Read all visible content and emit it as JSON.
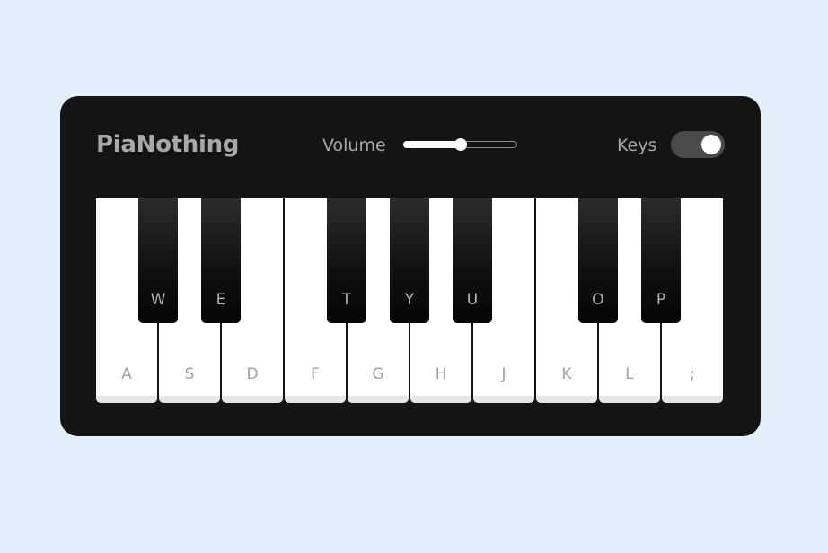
{
  "app": {
    "title": "PiaNothing"
  },
  "controls": {
    "volume_label": "Volume",
    "volume_level": 0.5,
    "keys_label": "Keys",
    "keys_toggle_on": true
  },
  "keyboard": {
    "white_keys": [
      {
        "label": "A"
      },
      {
        "label": "S"
      },
      {
        "label": "D"
      },
      {
        "label": "F"
      },
      {
        "label": "G"
      },
      {
        "label": "H"
      },
      {
        "label": "J"
      },
      {
        "label": "K"
      },
      {
        "label": "L"
      },
      {
        "label": ";"
      }
    ],
    "black_keys": [
      {
        "label": "W",
        "after_white": 0
      },
      {
        "label": "E",
        "after_white": 1
      },
      {
        "label": "T",
        "after_white": 3
      },
      {
        "label": "Y",
        "after_white": 4
      },
      {
        "label": "U",
        "after_white": 5
      },
      {
        "label": "O",
        "after_white": 7
      },
      {
        "label": "P",
        "after_white": 8
      }
    ]
  },
  "colors": {
    "page_background": "#e3f0fc",
    "panel_background": "#141414",
    "title_text": "#a8a8a8",
    "white_key": "#ffffff",
    "black_key": "#111111"
  }
}
